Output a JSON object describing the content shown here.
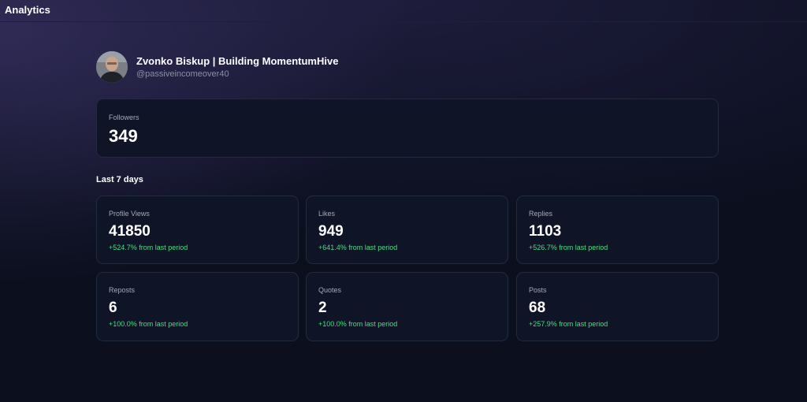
{
  "app": {
    "title": "Analytics"
  },
  "profile": {
    "display_name": "Zvonko Biskup | Building MomentumHive",
    "handle": "@passiveincomeover40"
  },
  "followers": {
    "label": "Followers",
    "value": "349"
  },
  "section": {
    "title": "Last 7 days"
  },
  "stats": [
    {
      "label": "Profile Views",
      "value": "41850",
      "change": "+524.7% from last period"
    },
    {
      "label": "Likes",
      "value": "949",
      "change": "+641.4% from last period"
    },
    {
      "label": "Replies",
      "value": "1103",
      "change": "+526.7% from last period"
    },
    {
      "label": "Reposts",
      "value": "6",
      "change": "+100.0% from last period"
    },
    {
      "label": "Quotes",
      "value": "2",
      "change": "+100.0% from last period"
    },
    {
      "label": "Posts",
      "value": "68",
      "change": "+257.9% from last period"
    }
  ],
  "colors": {
    "background": "#0b0f1e",
    "card": "#0f1526",
    "positive_change": "#4ade80",
    "muted_text": "#8a90a2"
  }
}
